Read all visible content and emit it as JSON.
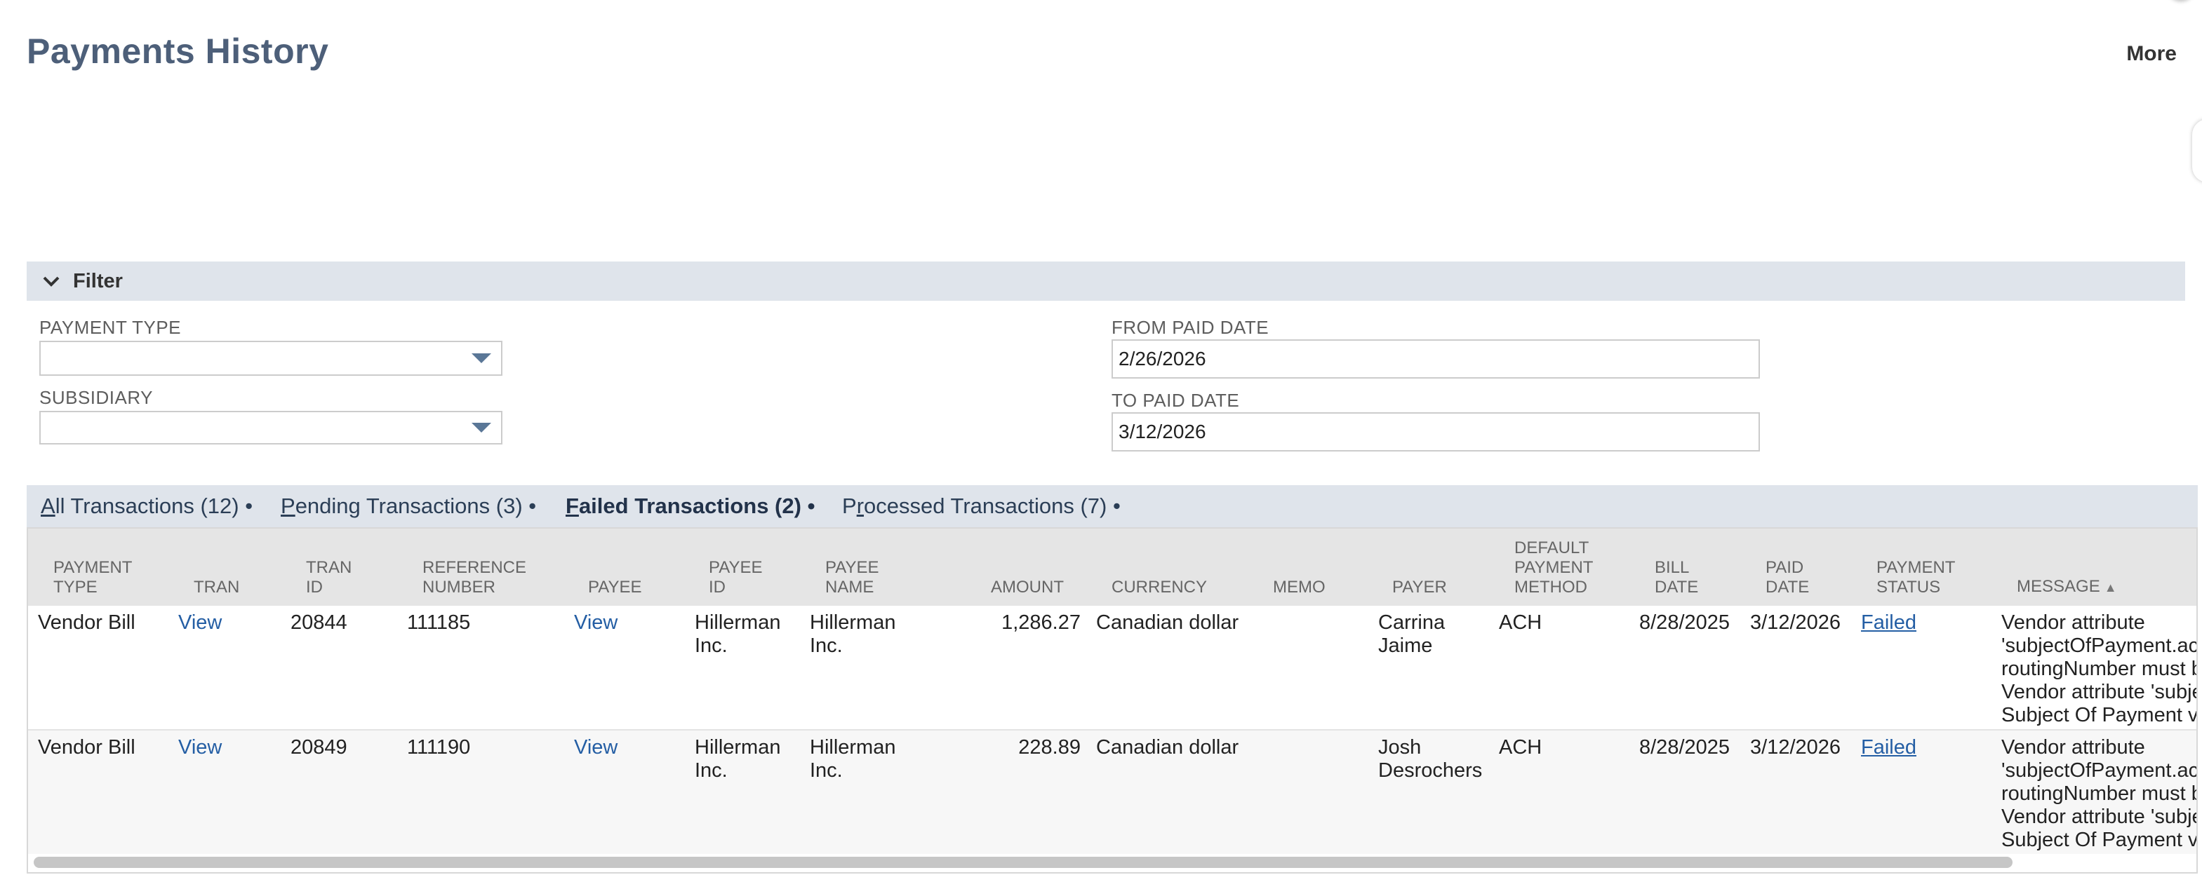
{
  "header": {
    "title": "Payments History",
    "more_label": "More"
  },
  "filter": {
    "label": "Filter",
    "payment_type": {
      "label": "PAYMENT TYPE",
      "value": ""
    },
    "subsidiary": {
      "label": "SUBSIDIARY",
      "value": ""
    },
    "from_paid_date": {
      "label": "FROM PAID DATE",
      "value": "2/26/2026"
    },
    "to_paid_date": {
      "label": "TO PAID DATE",
      "value": "3/12/2026"
    }
  },
  "tabs": [
    {
      "label": "All Transactions (12)",
      "accesskey": "A",
      "rest": "ll Transactions (12)",
      "dot": "•"
    },
    {
      "label": "Pending Transactions (3)",
      "accesskey": "P",
      "rest": "ending Transactions (3)",
      "dot": "•"
    },
    {
      "label": "Failed Transactions (2)",
      "accesskey": "F",
      "rest": "ailed Transactions (2)",
      "dot": "•"
    },
    {
      "label": "Processed Transactions (7)",
      "pre": "P",
      "accesskey": "r",
      "rest": "ocessed Transactions (7)",
      "dot": "•"
    }
  ],
  "table": {
    "columns": [
      [
        "PAYMENT",
        "TYPE"
      ],
      [
        "TRAN"
      ],
      [
        "TRAN",
        "ID"
      ],
      [
        "REFERENCE",
        "NUMBER"
      ],
      [
        "PAYEE"
      ],
      [
        "PAYEE",
        "ID"
      ],
      [
        "PAYEE",
        "NAME"
      ],
      [
        "AMOUNT"
      ],
      [
        "CURRENCY"
      ],
      [
        "MEMO"
      ],
      [
        "PAYER"
      ],
      [
        "DEFAULT",
        "PAYMENT",
        "METHOD"
      ],
      [
        "BILL",
        "DATE"
      ],
      [
        "PAID",
        "DATE"
      ],
      [
        "PAYMENT",
        "STATUS"
      ],
      [
        "MESSAGE"
      ]
    ],
    "sort_indicator": "▲",
    "rows": [
      {
        "payment_type": "Vendor Bill",
        "tran": "View",
        "tran_id": "20844",
        "reference_number": "111185",
        "payee": "View",
        "payee_id": [
          "Hillerman",
          "Inc."
        ],
        "payee_name": [
          "Hillerman",
          "Inc."
        ],
        "amount": "1,286.27",
        "currency": "Canadian dollar",
        "memo": "",
        "payer": [
          "Carrina",
          "Jaime"
        ],
        "default_payment_method": "ACH",
        "bill_date": "8/28/2025",
        "paid_date": "3/12/2026",
        "payment_status": "Failed",
        "message": [
          "Vendor attribute",
          "'subjectOfPayment.ac",
          "routingNumber must b",
          "Vendor attribute 'subje",
          "Subject Of Payment v"
        ]
      },
      {
        "payment_type": "Vendor Bill",
        "tran": "View",
        "tran_id": "20849",
        "reference_number": "111190",
        "payee": "View",
        "payee_id": [
          "Hillerman",
          "Inc."
        ],
        "payee_name": [
          "Hillerman",
          "Inc."
        ],
        "amount": "228.89",
        "currency": "Canadian dollar",
        "memo": "",
        "payer": [
          "Josh",
          "Desrochers"
        ],
        "default_payment_method": "ACH",
        "bill_date": "8/28/2025",
        "paid_date": "3/12/2026",
        "payment_status": "Failed",
        "message": [
          "Vendor attribute",
          "'subjectOfPayment.ac",
          "routingNumber must b",
          "Vendor attribute 'subje",
          "Subject Of Payment v"
        ]
      }
    ]
  },
  "colors": {
    "title": "#4d5f79",
    "band": "#dfe4eb",
    "link": "#245ea4",
    "header_bg": "#e5e5e5"
  }
}
